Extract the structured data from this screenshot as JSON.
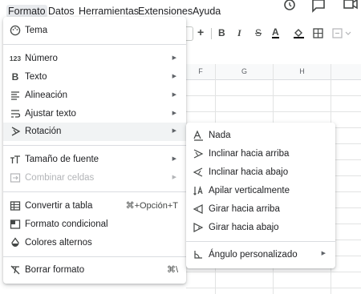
{
  "menubar": {
    "items": [
      "Formato",
      "Datos",
      "Herramientas",
      "Extensiones",
      "Ayuda"
    ]
  },
  "toolbar": {
    "icons": [
      "+",
      "B",
      "I",
      "S",
      "A"
    ]
  },
  "sheet": {
    "columns": [
      "F",
      "G",
      "H"
    ]
  },
  "menu": {
    "items": [
      {
        "icon": "palette-icon",
        "label": "Tema"
      },
      {
        "icon": "number-format-icon",
        "label": "Número",
        "icon_text": "123"
      },
      {
        "icon": "text-bold-icon",
        "label": "Texto",
        "icon_text": "B"
      },
      {
        "icon": "align-icon",
        "label": "Alineación"
      },
      {
        "icon": "wrap-text-icon",
        "label": "Ajustar texto"
      },
      {
        "icon": "text-rotation-icon",
        "label": "Rotación"
      },
      {
        "icon": "font-size-icon",
        "label": "Tamaño de fuente"
      },
      {
        "icon": "merge-cells-icon",
        "label": "Combinar celdas"
      },
      {
        "icon": "table-icon",
        "label": "Convertir a tabla",
        "shortcut": "⌘+Opción+T"
      },
      {
        "icon": "conditional-format-icon",
        "label": "Formato condicional"
      },
      {
        "icon": "alternating-colors-icon",
        "label": "Colores alternos"
      },
      {
        "icon": "clear-format-icon",
        "label": "Borrar formato",
        "shortcut": "⌘\\"
      }
    ]
  },
  "submenu": {
    "items": [
      {
        "icon": "rotation-none-icon",
        "label": "Nada"
      },
      {
        "icon": "tilt-up-icon",
        "label": "Inclinar hacia arriba"
      },
      {
        "icon": "tilt-down-icon",
        "label": "Inclinar hacia abajo"
      },
      {
        "icon": "stack-vertical-icon",
        "label": "Apilar verticalmente"
      },
      {
        "icon": "rotate-up-icon",
        "label": "Girar hacia arriba"
      },
      {
        "icon": "rotate-down-icon",
        "label": "Girar hacia abajo"
      },
      {
        "icon": "custom-angle-icon",
        "label": "Ángulo personalizado"
      }
    ]
  }
}
